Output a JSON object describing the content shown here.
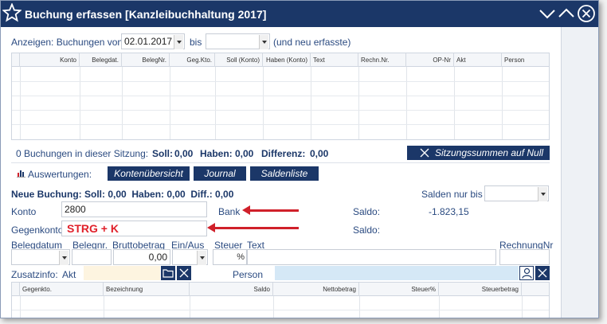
{
  "window": {
    "title": "Buchung erfassen [Kanzleibuchhaltung 2017]"
  },
  "filter": {
    "label": "Anzeigen: Buchungen von",
    "from_value": "02.01.2017",
    "to_label": "bis",
    "to_value": "",
    "suffix": "(und neu erfasste)"
  },
  "bookings_table": {
    "columns": [
      "Konto",
      "Belegdat.",
      "BelegNr.",
      "Geg.Kto.",
      "Soll (Konto)",
      "Haben (Konto)",
      "Text",
      "Rechn.Nr.",
      "OP-Nr",
      "Akt",
      "Person"
    ]
  },
  "session": {
    "count_text": "0 Buchungen in dieser Sitzung:",
    "soll_label": "Soll:",
    "soll_value": "0,00",
    "haben_label": "Haben:",
    "haben_value": "0,00",
    "diff_label": "Differenz:",
    "diff_value": "0,00",
    "reset_button": "Sitzungssummen auf Null"
  },
  "evaluations": {
    "label": "Auswertungen:",
    "buttons": [
      "Kontenübersicht",
      "Journal",
      "Saldenliste"
    ]
  },
  "new_booking": {
    "header": "Neue Buchung: Soll: 0,00  Haben: 0,00  Diff.: 0,00",
    "salden_label": "Salden nur bis",
    "salden_value": "",
    "konto_label": "Konto",
    "konto_value": "2800",
    "konto_name": "Bank",
    "saldo_label": "Saldo:",
    "saldo_value": "-1.823,15",
    "gegenkonto_label": "Gegenkonto",
    "gegenkonto_annotation": "STRG + K",
    "saldo2_label": "Saldo:",
    "belegdatum_label": "Belegdatum",
    "belegnr_label": "Belegnr.",
    "bruttobetrag_label": "Bruttobetrag",
    "bruttobetrag_value": "0,00",
    "einaus_label": "Ein/Aus",
    "steuer_label": "Steuer",
    "steuer_unit": "%",
    "text_label": "Text",
    "rechnungnr_label": "RechnungNr"
  },
  "extra": {
    "zusatzinfo_label": "Zusatzinfo:",
    "akt_label": "Akt",
    "person_label": "Person"
  },
  "split_table": {
    "columns": [
      "Gegenkto.",
      "Bezeichnung",
      "Saldo",
      "Nettobetrag",
      "Steuer%",
      "Steuerbetrag"
    ]
  },
  "colors": {
    "accent": "#1b3768",
    "arrow": "#d0202a",
    "annotation": "#e0202a"
  }
}
